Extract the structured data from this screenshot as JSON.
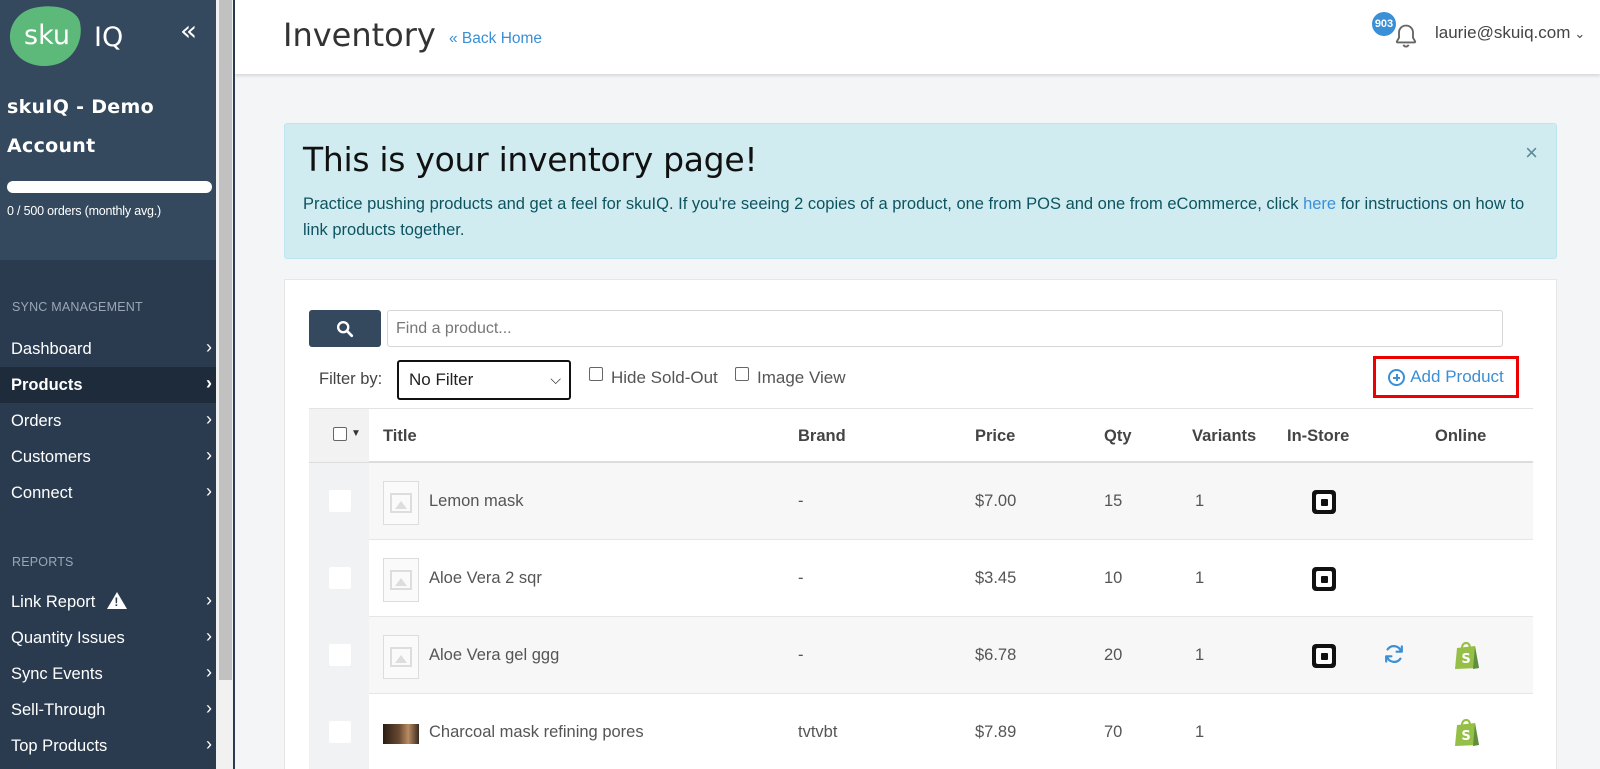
{
  "sidebar": {
    "logo": {
      "part1": "sku",
      "part2": "IQ"
    },
    "collapse_glyph": "«",
    "account_name_line1": "skuIQ - Demo",
    "account_name_line2": "Account",
    "orders_progress": 0.0,
    "orders_text": "0 / 500 orders (monthly avg.)",
    "sections": [
      {
        "heading": "SYNC MANAGEMENT",
        "items": [
          {
            "label": "Dashboard",
            "active": false
          },
          {
            "label": "Products",
            "active": true
          },
          {
            "label": "Orders",
            "active": false
          },
          {
            "label": "Customers",
            "active": false
          },
          {
            "label": "Connect",
            "active": false
          }
        ]
      },
      {
        "heading": "REPORTS",
        "items": [
          {
            "label": "Link Report",
            "icon": "warning-icon"
          },
          {
            "label": "Quantity Issues"
          },
          {
            "label": "Sync Events"
          },
          {
            "label": "Sell-Through"
          },
          {
            "label": "Top Products"
          }
        ]
      }
    ],
    "chevron_glyph": "›"
  },
  "header": {
    "title": "Inventory",
    "back_link": "« Back Home",
    "notification_count": "903",
    "user_email": "laurie@skuiq.com",
    "user_caret": "⌄"
  },
  "alert": {
    "heading": "This is your inventory page!",
    "text_before_link": "Practice pushing products and get a feel for skuIQ. If you're seeing 2 copies of a product, one from POS and one from eCommerce, click ",
    "link_text": "here",
    "text_after_link": " for instructions on how to link products together.",
    "close_glyph": "×"
  },
  "toolbar": {
    "search_placeholder": "Find a product...",
    "filter_label": "Filter by:",
    "filter_value": "No Filter",
    "hide_sold_out": "Hide Sold-Out",
    "image_view": "Image View",
    "add_product": "Add Product"
  },
  "table": {
    "columns": [
      "Title",
      "Brand",
      "Price",
      "Qty",
      "Variants",
      "In-Store",
      "Online"
    ],
    "rows": [
      {
        "title": "Lemon mask",
        "brand": "-",
        "price": "$7.00",
        "qty": "15",
        "variants": "1",
        "in_store": true,
        "sync": false,
        "online": false,
        "image": "placeholder"
      },
      {
        "title": "Aloe Vera 2 sqr",
        "brand": "-",
        "price": "$3.45",
        "qty": "10",
        "variants": "1",
        "in_store": true,
        "sync": false,
        "online": false,
        "image": "placeholder"
      },
      {
        "title": "Aloe Vera gel ggg",
        "brand": "-",
        "price": "$6.78",
        "qty": "20",
        "variants": "1",
        "in_store": true,
        "sync": true,
        "online": true,
        "image": "placeholder"
      },
      {
        "title": "Charcoal mask refining pores",
        "brand": "tvtvbt",
        "price": "$7.89",
        "qty": "70",
        "variants": "1",
        "in_store": false,
        "sync": false,
        "online": true,
        "image": "photo"
      }
    ]
  },
  "colors": {
    "sidebar_bg": "#2a3b4f",
    "accent_blue": "#3a8fd6",
    "logo_green": "#5cb97a",
    "shopify_green": "#95bf47",
    "highlight_red": "#e00000"
  }
}
